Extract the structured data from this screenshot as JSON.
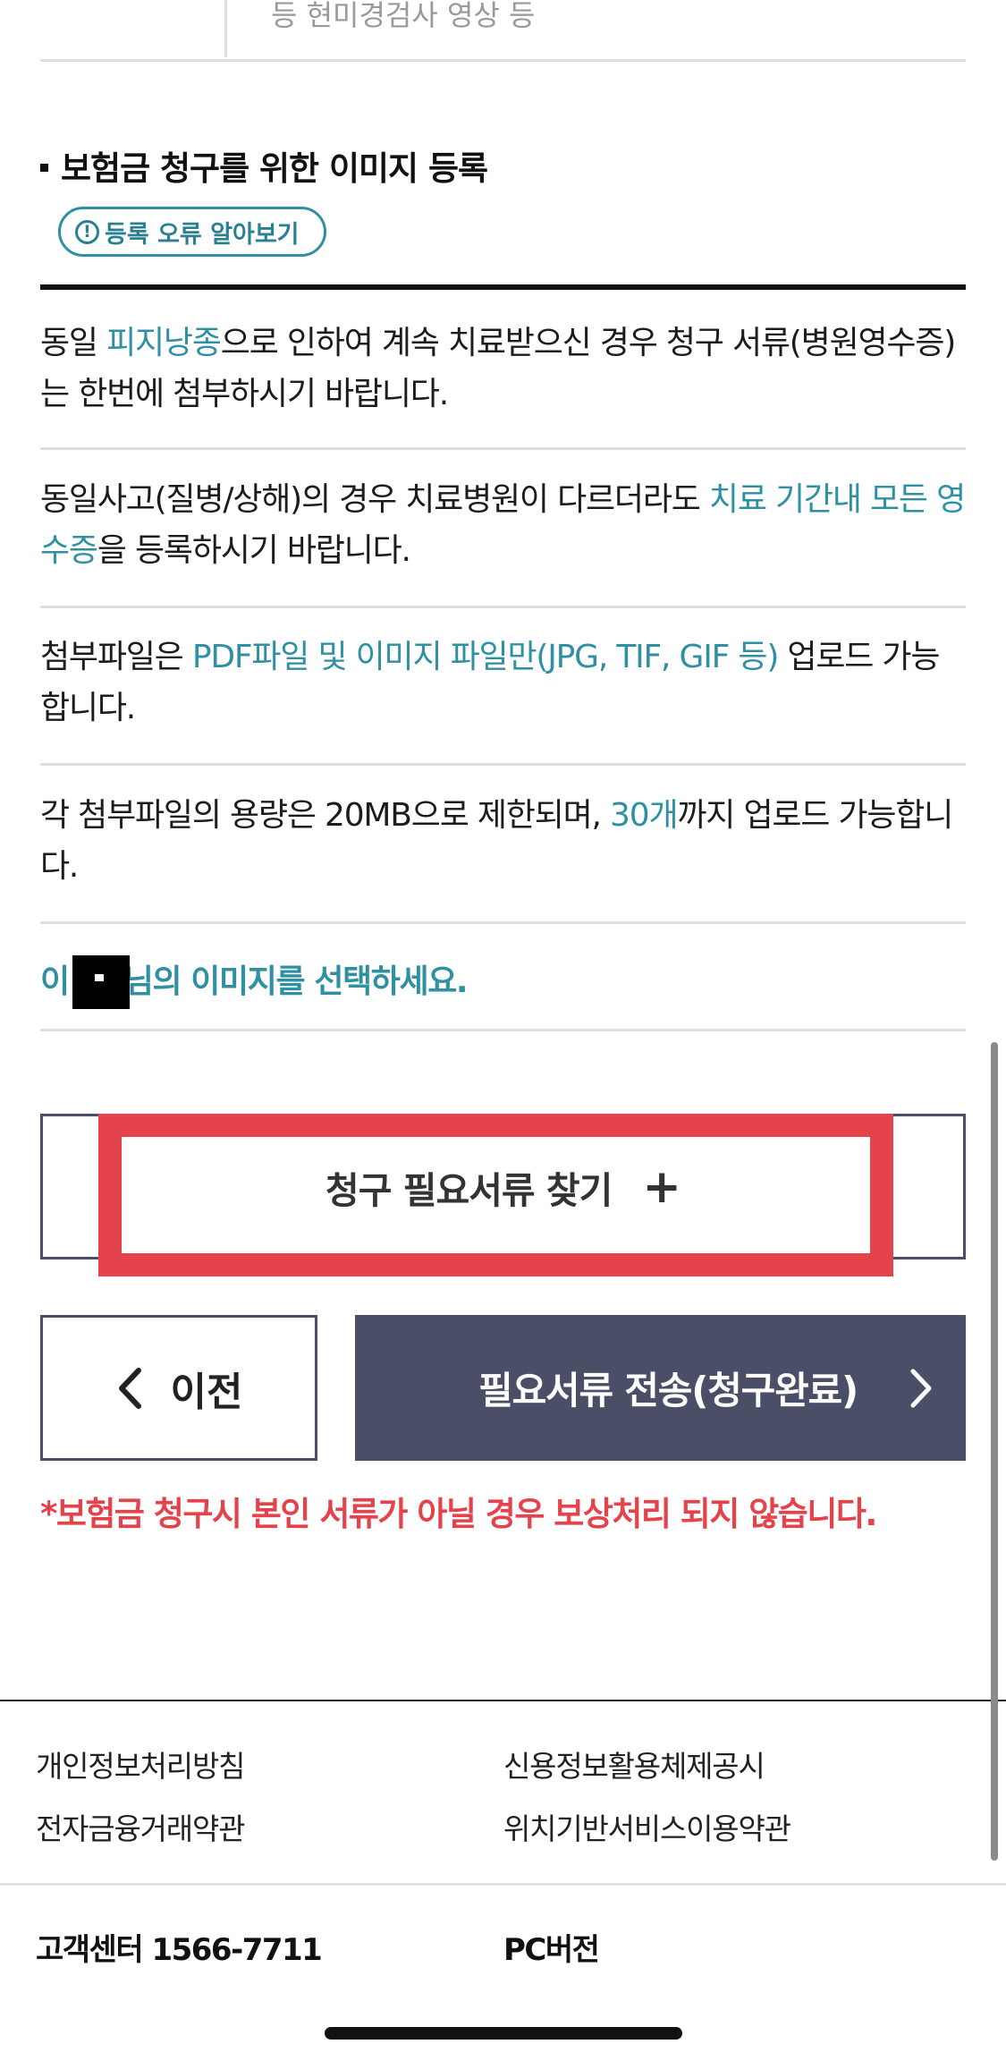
{
  "top_table": {
    "cell_text": "등 현미경검사 영상 등"
  },
  "section": {
    "title": "보험금 청구를 위한 이미지 등록",
    "error_pill_label": "등록 오류 알아보기",
    "info_icon_glyph": "!"
  },
  "notes": [
    [
      {
        "t": "동일 "
      },
      {
        "t": "피지낭종",
        "hl": true
      },
      {
        "t": "으로 인하여 계속 치료받으신 경우 청구 서류(병원영수증)는 한번에 첨부하시기 바랍니다."
      }
    ],
    [
      {
        "t": "동일사고(질병/상해)의 경우 치료병원이 다르더라도 "
      },
      {
        "t": "치료 기간내 모든 영수증",
        "hl": true
      },
      {
        "t": "을 등록하시기 바랍니다."
      }
    ],
    [
      {
        "t": "첨부파일은 "
      },
      {
        "t": "PDF파일 및 이미지 파일만(JPG, TIF, GIF 등)",
        "hl": true
      },
      {
        "t": " 업로드 가능합니다."
      }
    ],
    [
      {
        "t": "각 첨부파일의 용량은 20MB으로 제한되며, "
      },
      {
        "t": "30개",
        "hl": true
      },
      {
        "t": "까지 업로드 가능합니다."
      }
    ]
  ],
  "select_prompt": {
    "prefix": "이",
    "suffix": "님의 이미지를 선택하세요."
  },
  "buttons": {
    "find_docs": "청구 필요서류 찾기",
    "find_docs_plus": "+",
    "prev": "이전",
    "submit": "필요서류 전송(청구완료)"
  },
  "warning": "*보험금 청구시 본인 서류가 아닐 경우 보상처리 되지 않습니다.",
  "footer": {
    "links": [
      "개인정보처리방침",
      "신용정보활용체제공시",
      "전자금융거래약관",
      "위치기반서비스이용약관"
    ],
    "customer_center": "고객센터 1566-7711",
    "pc_version": "PC버전"
  },
  "colors": {
    "accent": "#2f8fa3",
    "button_dark": "#4a4e66",
    "warning_red": "#e5434b",
    "highlight_red": "#e5434b"
  },
  "icons": [
    "info-icon",
    "plus-icon",
    "chevron-left-icon",
    "chevron-right-icon"
  ]
}
